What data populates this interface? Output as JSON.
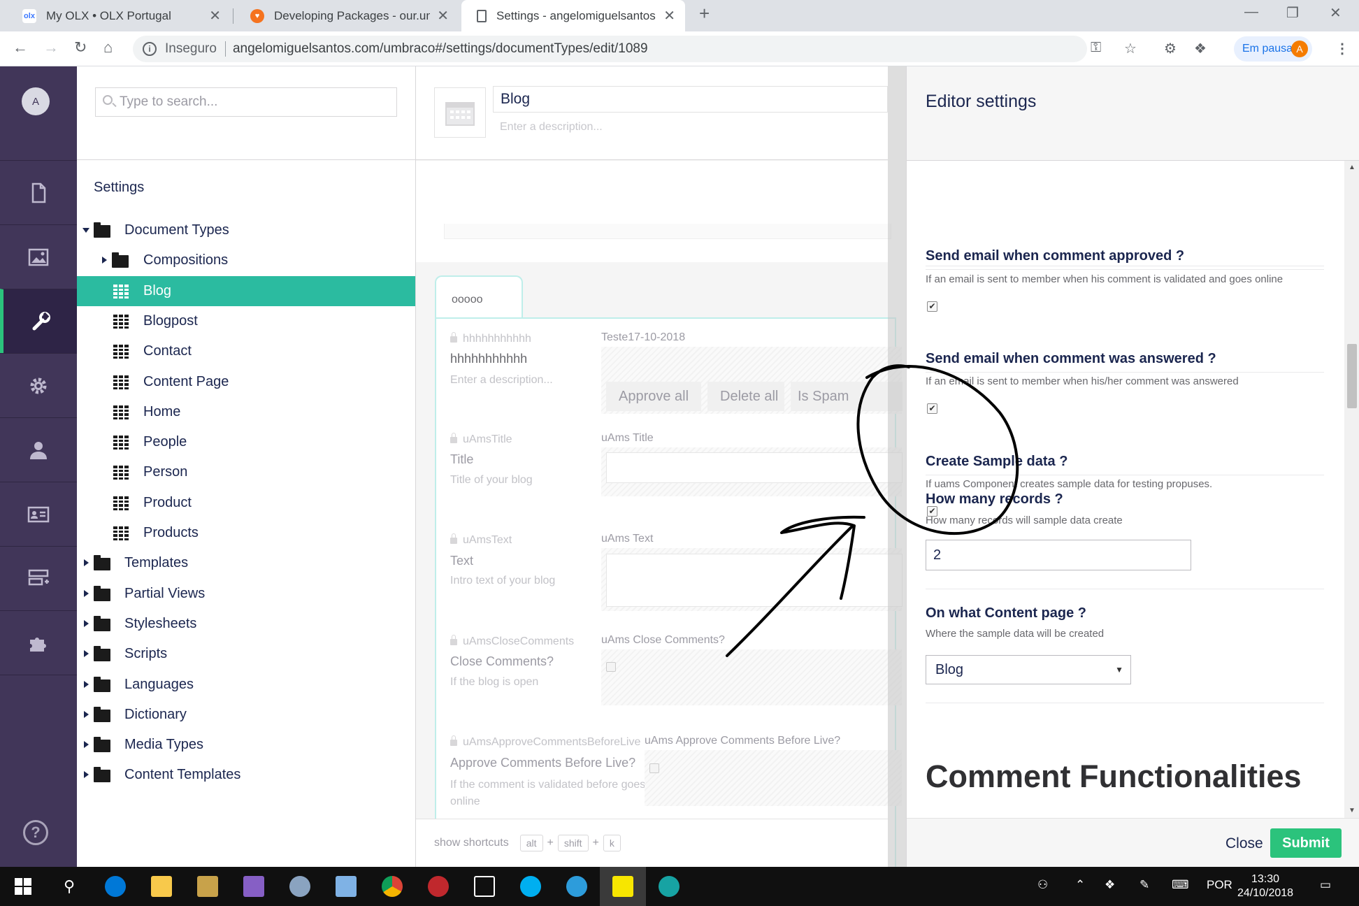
{
  "browser": {
    "tabs": [
      {
        "title": "My OLX • OLX Portugal",
        "favicon": "olx",
        "active": false
      },
      {
        "title": "Developing Packages - our.umbr",
        "favicon": "umbraco-heart",
        "active": false
      },
      {
        "title": "Settings - angelomiguelsantos.co",
        "favicon": "page",
        "active": true
      }
    ],
    "insecure_label": "Inseguro",
    "url": "angelomiguelsantos.com/umbraco#/settings/documentTypes/edit/1089",
    "pause_label": "Em pausa",
    "profile_initial": "A"
  },
  "leftnav": {
    "avatar_initial": "A",
    "sections": [
      "content-icon",
      "media-icon",
      "settings-wrench-icon",
      "developer-gear-icon",
      "users-icon",
      "members-icon",
      "forms-icon",
      "packages-puzzle-icon"
    ],
    "active_section": "settings-wrench-icon",
    "help": "?"
  },
  "tree": {
    "search_placeholder": "Type to search...",
    "title": "Settings",
    "nodes": [
      {
        "label": "Document Types",
        "icon": "folder",
        "level": 0,
        "caret": "down"
      },
      {
        "label": "Compositions",
        "icon": "folder",
        "level": 1,
        "caret": "right"
      },
      {
        "label": "Blog",
        "icon": "doctype",
        "level": 1,
        "selected": true
      },
      {
        "label": "Blogpost",
        "icon": "doctype",
        "level": 1
      },
      {
        "label": "Contact",
        "icon": "doctype",
        "level": 1
      },
      {
        "label": "Content Page",
        "icon": "doctype",
        "level": 1
      },
      {
        "label": "Home",
        "icon": "doctype",
        "level": 1
      },
      {
        "label": "People",
        "icon": "doctype",
        "level": 1
      },
      {
        "label": "Person",
        "icon": "doctype",
        "level": 1
      },
      {
        "label": "Product",
        "icon": "doctype",
        "level": 1
      },
      {
        "label": "Products",
        "icon": "doctype",
        "level": 1
      },
      {
        "label": "Templates",
        "icon": "folder",
        "level": 0,
        "caret": "right"
      },
      {
        "label": "Partial Views",
        "icon": "folder",
        "level": 0,
        "caret": "right"
      },
      {
        "label": "Stylesheets",
        "icon": "folder",
        "level": 0,
        "caret": "right"
      },
      {
        "label": "Scripts",
        "icon": "folder",
        "level": 0,
        "caret": "right"
      },
      {
        "label": "Languages",
        "icon": "folder",
        "level": 0,
        "caret": "right"
      },
      {
        "label": "Dictionary",
        "icon": "folder",
        "level": 0,
        "caret": "right"
      },
      {
        "label": "Media Types",
        "icon": "folder",
        "level": 0,
        "caret": "right"
      },
      {
        "label": "Content Templates",
        "icon": "folder",
        "level": 0,
        "caret": "right"
      }
    ]
  },
  "editor": {
    "name": "Blog",
    "description_placeholder": "Enter a description...",
    "group_tab": "ooooo",
    "properties": [
      {
        "alias": "hhhhhhhhhhh",
        "name": "hhhhhhhhhhh",
        "description": "Enter a description...",
        "preview_label": "Teste17-10-2018"
      },
      {
        "alias": "uAmsTitle",
        "name": "Title",
        "description": "Title of your blog",
        "preview_label": "uAms Title"
      },
      {
        "alias": "uAmsText",
        "name": "Text",
        "description": "Intro text of your blog",
        "preview_label": "uAms Text"
      },
      {
        "alias": "uAmsCloseComments",
        "name": "Close Comments?",
        "description": "If the blog is open",
        "preview_label": "uAms Close Comments?"
      },
      {
        "alias": "uAmsApproveCommentsBeforeLive",
        "name": "Approve Comments Before Live?",
        "description": "If the comment is validated before goes online",
        "preview_label": "uAms Approve Comments Before Live?"
      }
    ],
    "buttons": [
      "Approve all",
      "Delete all",
      "Is Spam"
    ],
    "shortcuts_label": "show shortcuts",
    "shortcut_keys": [
      "alt",
      "+",
      "shift",
      "+",
      "k"
    ]
  },
  "dialog": {
    "title": "Editor settings",
    "settings": [
      {
        "title": "Send email when comment approved ?",
        "description": "If an email is sent to member when his comment is validated and goes online",
        "checked": true
      },
      {
        "title": "Send email when comment was answered ?",
        "description": "If an email is sent to member when his/her comment was answered",
        "checked": true
      },
      {
        "title": "Create Sample data ?",
        "description": "If uams Component creates sample data for testing propuses.",
        "checked": true
      },
      {
        "title": "How many records ?",
        "description": "How many records will sample data create",
        "value": "2"
      },
      {
        "title": "On what Content page ?",
        "description": "Where the sample data will be created",
        "selected": "Blog"
      }
    ],
    "section_heading": "Comment Functionalities",
    "close_label": "Close",
    "submit_label": "Submit"
  },
  "taskbar": {
    "language": "POR",
    "time": "13:30",
    "date": "24/10/2018"
  },
  "colors": {
    "umbraco_nav": "#413659",
    "tree_selected": "#2bbba0",
    "submit_green": "#2bc37c",
    "group_border": "#bfeeea",
    "annotation_ink": "#000000"
  }
}
